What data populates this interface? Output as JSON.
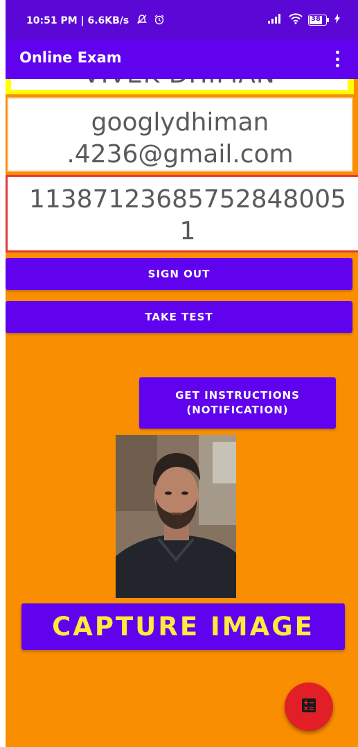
{
  "status_bar": {
    "time": "10:51 PM | 6.6KB/s",
    "battery": "38"
  },
  "app_bar": {
    "title": "Online Exam"
  },
  "profile": {
    "name": "VIVEK DHIMAN",
    "email": "googlydhiman\n.4236@gmail.com",
    "user_id": "113871236857528480051"
  },
  "buttons": {
    "sign_out": "SIGN OUT",
    "take_test": "TAKE TEST",
    "get_instructions_line1": "GET INSTRUCTIONS",
    "get_instructions_line2": "(NOTIFICATION)",
    "capture_image": "CAPTURE IMAGE"
  },
  "icons": {
    "overflow": "overflow-menu-icon",
    "fab": "calculator-icon"
  },
  "colors": {
    "background": "#F98E00",
    "primary": "#6002EE",
    "primary_dark": "#5B08D6",
    "capture_text": "#FFEB3B",
    "fab": "#E21F26",
    "id_border": "#E53935",
    "name_border": "#FFFF00"
  }
}
